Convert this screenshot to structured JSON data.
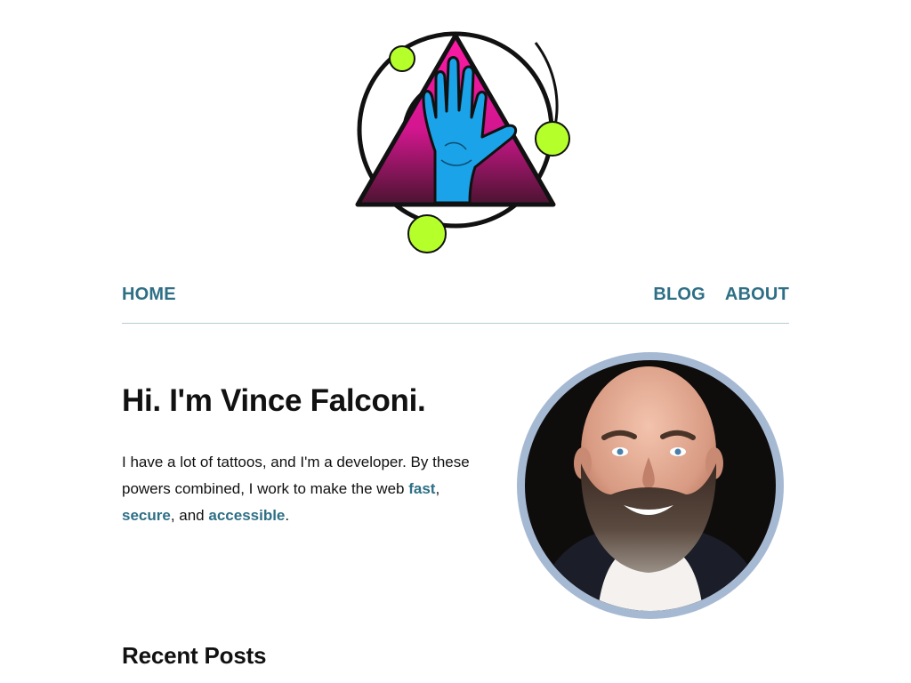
{
  "site": {
    "logo_icon": "hand-triangle-logo-icon",
    "colors": {
      "accent": "#2e6f86",
      "triangle_top": "#ff1aa6",
      "triangle_bottom": "#5a1a3a",
      "hand": "#1aa3e8",
      "orbs": "#b5ff2a",
      "avatar_ring": "#a6b9d3"
    }
  },
  "nav": {
    "home": "HOME",
    "blog": "BLOG",
    "about": "ABOUT"
  },
  "intro": {
    "heading": "Hi. I'm Vince Falconi.",
    "text_before": "I have a lot of tattoos, and I'm a developer. By these powers combined, I work to make the web ",
    "link_fast": "fast",
    "sep1": ", ",
    "link_secure": "secure",
    "sep2": ", and ",
    "link_accessible": "accessible",
    "end": "."
  },
  "avatar": {
    "icon": "profile-photo-avatar"
  },
  "recent_posts": {
    "heading": "Recent Posts"
  }
}
